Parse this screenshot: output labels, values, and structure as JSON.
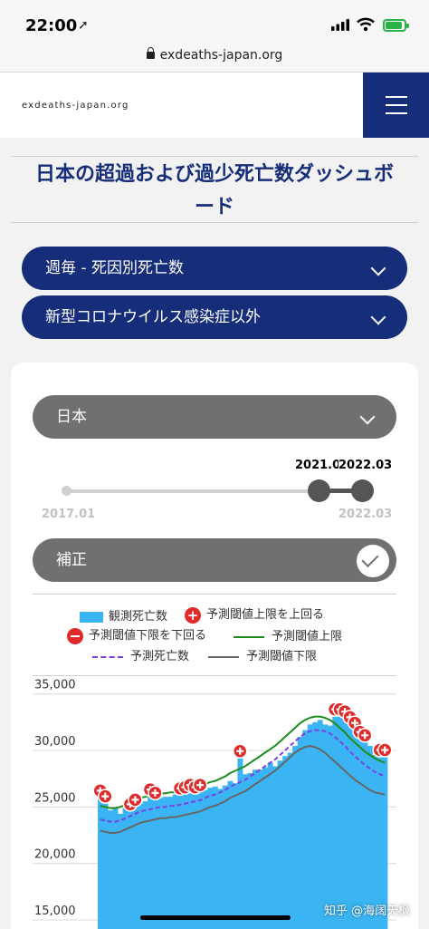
{
  "status_bar": {
    "time": "22:00"
  },
  "url_bar": {
    "url": "exdeaths-japan.org"
  },
  "header": {
    "site_name": "exdeaths-japan.org"
  },
  "page": {
    "title": "日本の超過および過少死亡数ダッシュボード"
  },
  "dropdowns": {
    "metric": "週毎 - 死因別死亡数",
    "cause": "新型コロナウイルス感染症以外",
    "region": "日本"
  },
  "range_slider": {
    "min_label": "2017.01",
    "max_label": "2022.03",
    "start_selected": "2021.0",
    "end_selected": "2022.03",
    "selected_fraction_start": 0.85,
    "selected_fraction_end": 1.0
  },
  "adjustment_toggle": {
    "label": "補正",
    "checked": true
  },
  "legend": {
    "observed": "観測死亡数",
    "above_upper": "予測閾値上限を上回る",
    "below_lower": "予測閾値下限を下回る",
    "upper_threshold": "予測閾値上限",
    "expected": "予測死亡数",
    "lower_threshold": "予測閾値下限"
  },
  "colors": {
    "navy": "#162d7a",
    "bar": "#3ab4f2",
    "upper": "#1e8c1e",
    "expected": "#7b3fe4",
    "lower": "#666666",
    "marker": "#e02b2b"
  },
  "chart_data": {
    "type": "bar",
    "ylim": [
      15000,
      35000
    ],
    "yticks": [
      "35,000",
      "30,000",
      "25,000",
      "20,000",
      "15,000"
    ],
    "ytick_values": [
      35000,
      30000,
      25000,
      20000,
      15000
    ],
    "grid": true,
    "series": [
      {
        "name": "観測死亡数",
        "values": [
          25800,
          25300,
          24700,
          24900,
          24400,
          24900,
          24600,
          25000,
          25300,
          25500,
          25900,
          25600,
          25800,
          25900,
          25900,
          26100,
          26000,
          26100,
          26300,
          26100,
          26300,
          26500,
          26700,
          26800,
          26600,
          26900,
          27300,
          27100,
          29300,
          27900,
          28000,
          28300,
          28300,
          28500,
          28900,
          28600,
          29100,
          29500,
          29800,
          30400,
          31200,
          31800,
          32300,
          32500,
          32700,
          32300,
          32200,
          33000,
          33000,
          32800,
          32300,
          31800,
          31000,
          30700,
          30400,
          29600,
          29400,
          29400
        ]
      },
      {
        "name": "予測閾値上限",
        "values": [
          25100,
          25000,
          24900,
          24900,
          25000,
          25200,
          25400,
          25600,
          25800,
          25900,
          26000,
          26100,
          26200,
          26200,
          26300,
          26300,
          26400,
          26500,
          26600,
          26700,
          26800,
          27000,
          27200,
          27300,
          27500,
          27700,
          28000,
          28200,
          28400,
          28600,
          28900,
          29200,
          29500,
          29800,
          30100,
          30400,
          30800,
          31200,
          31600,
          32000,
          32400,
          32700,
          32900,
          33000,
          33000,
          32900,
          32700,
          32400,
          32000,
          31600,
          31100,
          30700,
          30300,
          29900,
          29600,
          29300,
          29100,
          28900
        ]
      },
      {
        "name": "予測死亡数",
        "values": [
          23900,
          23800,
          23700,
          23700,
          23800,
          24000,
          24200,
          24400,
          24600,
          24700,
          24800,
          24900,
          25000,
          25000,
          25100,
          25100,
          25200,
          25300,
          25400,
          25500,
          25600,
          25800,
          26000,
          26100,
          26300,
          26500,
          26800,
          27000,
          27200,
          27400,
          27700,
          28000,
          28300,
          28600,
          28900,
          29200,
          29600,
          30000,
          30400,
          30800,
          31200,
          31500,
          31700,
          31800,
          31800,
          31700,
          31500,
          31200,
          30800,
          30400,
          29900,
          29500,
          29100,
          28700,
          28400,
          28100,
          27900,
          27700
        ]
      },
      {
        "name": "予測閾値下限",
        "values": [
          22900,
          22800,
          22700,
          22700,
          22800,
          23000,
          23200,
          23400,
          23600,
          23700,
          23800,
          23900,
          24000,
          24000,
          24100,
          24100,
          24200,
          24300,
          24400,
          24500,
          24600,
          24800,
          25000,
          25100,
          25300,
          25500,
          25800,
          26000,
          26200,
          26400,
          26700,
          27000,
          27300,
          27600,
          27900,
          28200,
          28600,
          29000,
          29400,
          29800,
          30100,
          30300,
          30400,
          30300,
          30100,
          29800,
          29400,
          29000,
          28600,
          28200,
          27800,
          27400,
          27100,
          26800,
          26500,
          26300,
          26200,
          26100
        ]
      }
    ],
    "above_upper_indices": [
      0,
      1,
      6,
      7,
      10,
      11,
      16,
      17,
      18,
      19,
      20,
      28,
      47,
      48,
      49,
      50,
      51,
      52,
      53,
      56,
      57
    ]
  },
  "watermark": "知乎 @海阔天枫"
}
